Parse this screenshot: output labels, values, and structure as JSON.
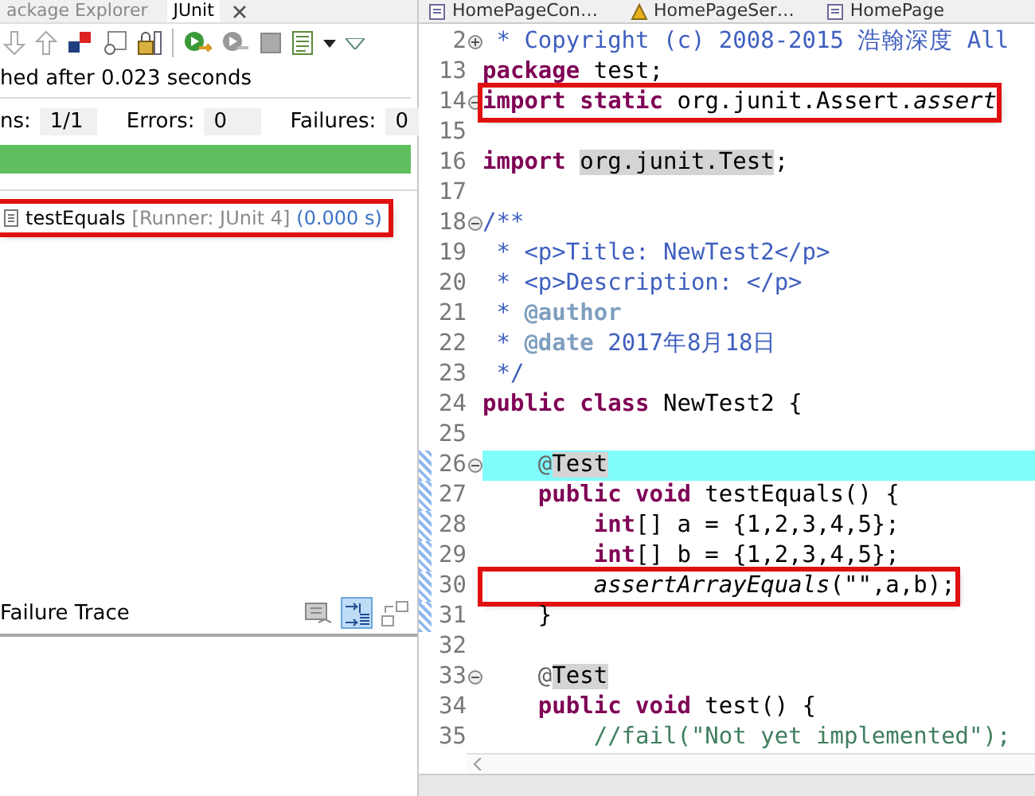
{
  "junit_view": {
    "tabs": [
      {
        "label": "ackage Explorer",
        "selected": false
      },
      {
        "label": "JUnit",
        "selected": true
      }
    ],
    "status": "hed after 0.023 seconds",
    "counters": [
      {
        "label": "ns:",
        "value": "1/1",
        "kind": "runs"
      },
      {
        "label": "Errors:",
        "value": "0",
        "kind": "errors"
      },
      {
        "label": "Failures:",
        "value": "0",
        "kind": "failures"
      }
    ],
    "progress": {
      "level": 1
    },
    "tests": [
      {
        "name": "testEquals",
        "runner": "[Runner: JUnit 4]",
        "time": "(0.000 s)",
        "boxed": true
      }
    ],
    "trace": {
      "title": "Failure Trace",
      "tools": [
        {
          "kind": "compare",
          "on": false
        },
        {
          "kind": "filter",
          "on": true
        },
        {
          "kind": "layout",
          "on": false
        }
      ]
    }
  },
  "editor": {
    "tabs": [
      {
        "label": "HomePageCon…",
        "kind": "file"
      },
      {
        "label": "HomePageSer…",
        "kind": "warning"
      },
      {
        "label": "HomePage",
        "kind": "file"
      }
    ],
    "lines": [
      {
        "num": "2",
        "expanded": false,
        "changed": false,
        "current": false,
        "boxed": false,
        "segs": [
          {
            "kind": "comment",
            "t": " * Copyright (c) 2008-2015 浩翰深度 All"
          }
        ]
      },
      {
        "num": "13",
        "changed": false,
        "current": false,
        "boxed": false,
        "segs": [
          {
            "kind": "kw",
            "t": "package"
          },
          {
            "kind": "plain",
            "t": " test;"
          }
        ]
      },
      {
        "num": "14",
        "expanded": true,
        "changed": false,
        "current": false,
        "boxed": true,
        "segs": [
          {
            "kind": "kw",
            "t": "import static"
          },
          {
            "kind": "plain",
            "t": " org.junit.Assert."
          },
          {
            "kind": "italic",
            "t": "assert"
          }
        ]
      },
      {
        "num": "15",
        "changed": false,
        "current": false
      },
      {
        "num": "16",
        "changed": false,
        "current": false,
        "boxed": false,
        "segs": [
          {
            "kind": "kw",
            "t": "import "
          },
          {
            "kind": "occurrence",
            "t": "org.junit.Test"
          },
          {
            "kind": "plain",
            "t": ";"
          }
        ]
      },
      {
        "num": "17",
        "changed": false,
        "current": false
      },
      {
        "num": "18",
        "expanded": true,
        "changed": false,
        "current": false,
        "boxed": false,
        "segs": [
          {
            "kind": "comment",
            "t": "/**"
          }
        ]
      },
      {
        "num": "19",
        "changed": false,
        "current": false,
        "boxed": false,
        "segs": [
          {
            "kind": "comment",
            "t": " * <p>Title: NewTest2</p>"
          }
        ]
      },
      {
        "num": "20",
        "changed": false,
        "current": false,
        "boxed": false,
        "segs": [
          {
            "kind": "comment",
            "t": " * <p>Description: </p>"
          }
        ]
      },
      {
        "num": "21",
        "changed": false,
        "current": false,
        "boxed": false,
        "segs": [
          {
            "kind": "comment",
            "t": " * "
          },
          {
            "kind": "tag",
            "t": "@author"
          }
        ]
      },
      {
        "num": "22",
        "changed": false,
        "current": false,
        "boxed": false,
        "segs": [
          {
            "kind": "comment",
            "t": " * "
          },
          {
            "kind": "tag",
            "t": "@date"
          },
          {
            "kind": "comment",
            "t": " 2017年8月18日"
          }
        ]
      },
      {
        "num": "23",
        "changed": false,
        "current": false,
        "boxed": false,
        "segs": [
          {
            "kind": "comment",
            "t": " */"
          }
        ]
      },
      {
        "num": "24",
        "changed": false,
        "current": false,
        "boxed": false,
        "segs": [
          {
            "kind": "kw",
            "t": "public class"
          },
          {
            "kind": "plain",
            "t": " NewTest2 {"
          }
        ]
      },
      {
        "num": "25",
        "changed": false,
        "current": false
      },
      {
        "num": "26",
        "expanded": true,
        "changed": true,
        "current": true,
        "boxed": false,
        "segs": [
          {
            "kind": "annot",
            "t": "    @"
          },
          {
            "kind": "occurrence",
            "t": "Test"
          }
        ]
      },
      {
        "num": "27",
        "changed": true,
        "current": false,
        "boxed": false,
        "segs": [
          {
            "kind": "kw",
            "t": "    public void"
          },
          {
            "kind": "plain",
            "t": " testEquals() {"
          }
        ]
      },
      {
        "num": "28",
        "changed": true,
        "current": false,
        "boxed": false,
        "segs": [
          {
            "kind": "kw",
            "t": "        int"
          },
          {
            "kind": "plain",
            "t": "[] a = {1,2,3,4,5};"
          }
        ]
      },
      {
        "num": "29",
        "changed": true,
        "current": false,
        "boxed": false,
        "segs": [
          {
            "kind": "kw",
            "t": "        int"
          },
          {
            "kind": "plain",
            "t": "[] b = {1,2,3,4,5};"
          }
        ]
      },
      {
        "num": "30",
        "changed": true,
        "current": false,
        "boxed": true,
        "segs": [
          {
            "kind": "italic",
            "t": "        assertArrayEquals"
          },
          {
            "kind": "plain",
            "t": "(\"\",a,b);"
          }
        ]
      },
      {
        "num": "31",
        "changed": true,
        "current": false,
        "boxed": false,
        "segs": [
          {
            "kind": "plain",
            "t": "    }"
          }
        ]
      },
      {
        "num": "32",
        "changed": false,
        "current": false
      },
      {
        "num": "33",
        "expanded": true,
        "changed": false,
        "current": false,
        "boxed": false,
        "segs": [
          {
            "kind": "annot",
            "t": "    @"
          },
          {
            "kind": "occurrence",
            "t": "Test"
          }
        ]
      },
      {
        "num": "34",
        "changed": false,
        "current": false,
        "boxed": false,
        "segs": [
          {
            "kind": "kw",
            "t": "    public void"
          },
          {
            "kind": "plain",
            "t": " test() {"
          }
        ]
      },
      {
        "num": "35",
        "changed": false,
        "current": false,
        "boxed": false,
        "segs": [
          {
            "kind": "linecomment",
            "t": "        //fail(\"Not yet implemented\");"
          }
        ]
      }
    ]
  }
}
